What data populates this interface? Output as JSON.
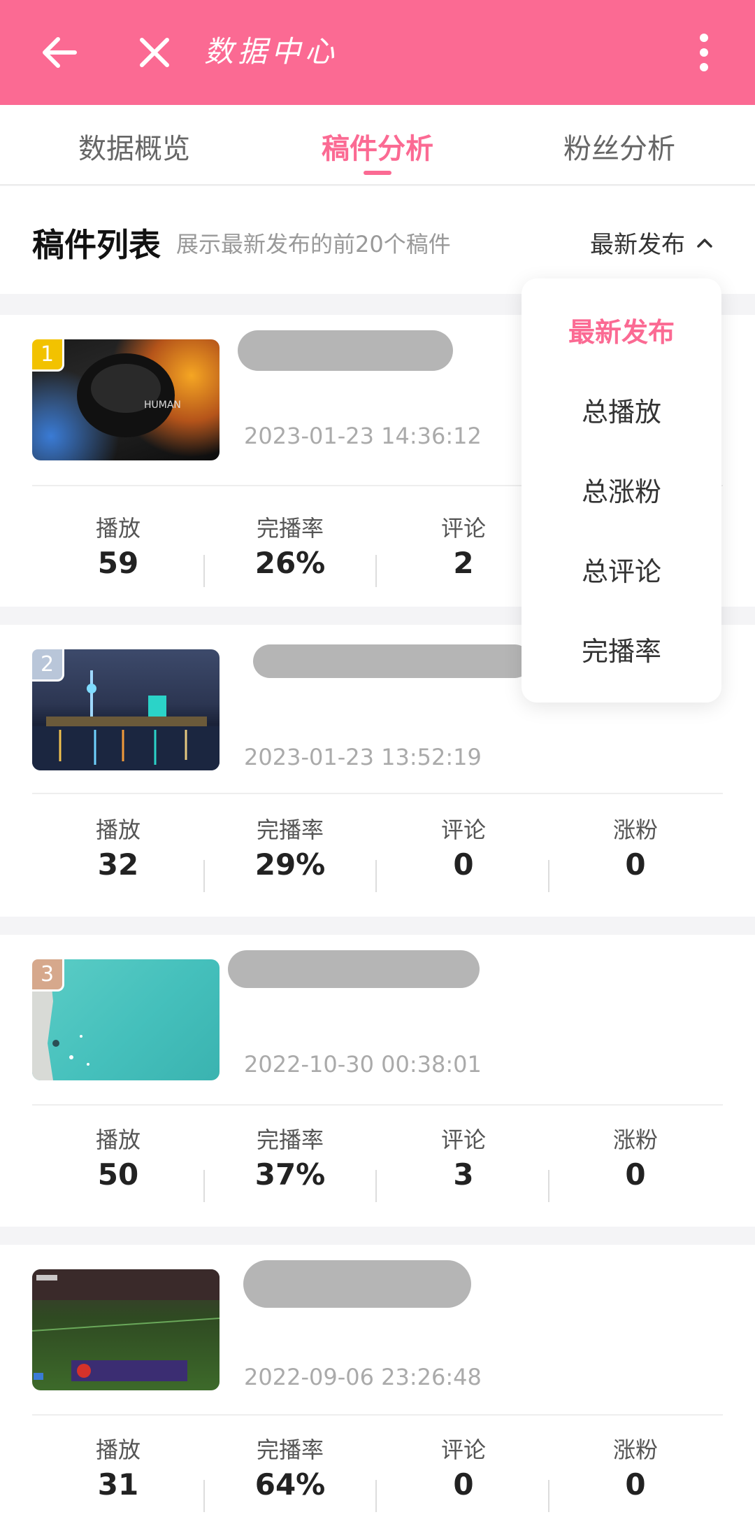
{
  "header": {
    "title": "数据中心",
    "back_icon": "arrow-left-icon",
    "close_icon": "close-icon",
    "more_icon": "more-vertical-icon",
    "color": "#fb6a93"
  },
  "tabs": [
    {
      "label": "数据概览"
    },
    {
      "label": "稿件分析",
      "active": true
    },
    {
      "label": "粉丝分析"
    }
  ],
  "list": {
    "title": "稿件列表",
    "subtitle": "展示最新发布的前20个稿件",
    "sort_label": "最新发布"
  },
  "dropdown": {
    "options": [
      "最新发布",
      "总播放",
      "总涨粉",
      "总评论",
      "完播率"
    ],
    "selected": "最新发布"
  },
  "stat_labels": {
    "plays": "播放",
    "completion": "完播率",
    "comments": "评论",
    "fans": "涨粉"
  },
  "items": [
    {
      "rank": "1",
      "date": "2023-01-23 14:36:12",
      "plays": "59",
      "completion": "26%",
      "comments": "2",
      "fans": ""
    },
    {
      "rank": "2",
      "date": "2023-01-23 13:52:19",
      "plays": "32",
      "completion": "29%",
      "comments": "0",
      "fans": "0"
    },
    {
      "rank": "3",
      "date": "2022-10-30 00:38:01",
      "plays": "50",
      "completion": "37%",
      "comments": "3",
      "fans": "0"
    },
    {
      "rank": "",
      "date": "2022-09-06 23:26:48",
      "plays": "31",
      "completion": "64%",
      "comments": "0",
      "fans": "0"
    }
  ]
}
